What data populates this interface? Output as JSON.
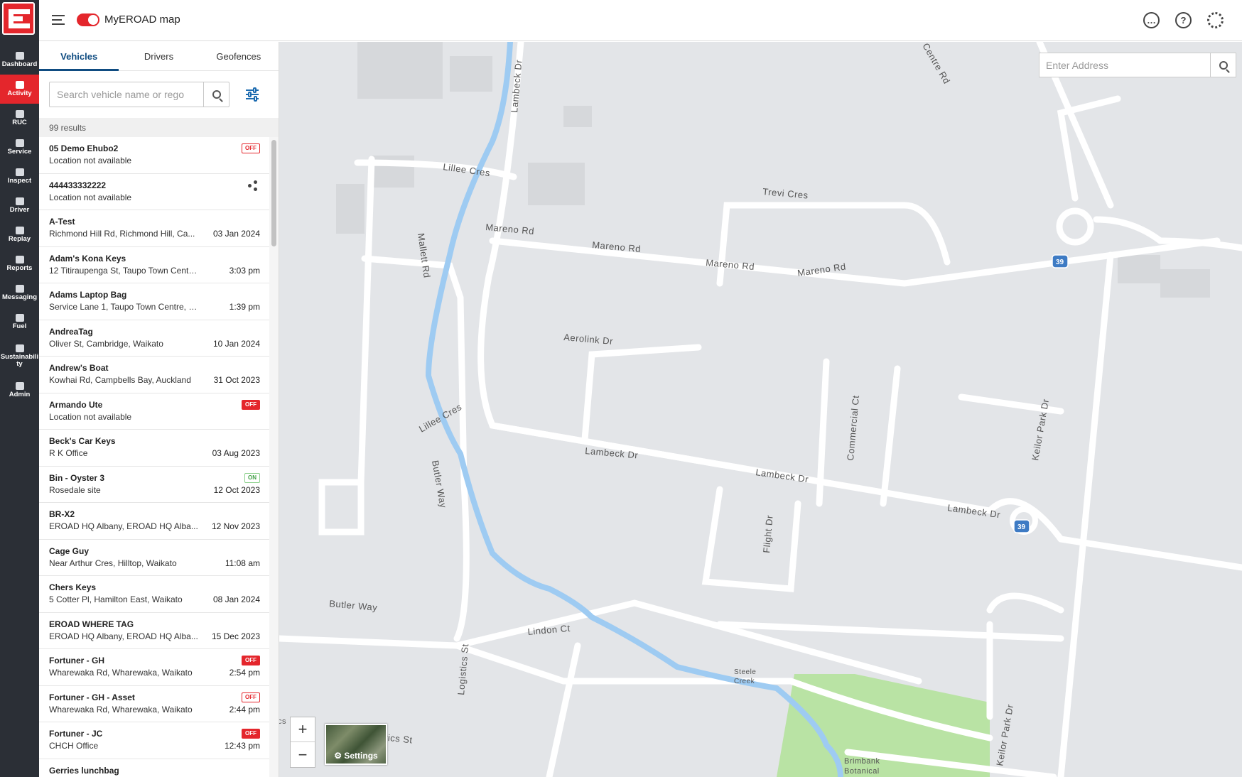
{
  "topbar": {
    "app_title": "MyEROAD map",
    "icons": [
      "chat-icon",
      "help-icon",
      "settings-gear-icon"
    ]
  },
  "rail": {
    "items": [
      {
        "label": "Dashboard",
        "icon": "dashboard-icon"
      },
      {
        "label": "Activity",
        "icon": "map-icon"
      },
      {
        "label": "RUC",
        "icon": "ruc-icon"
      },
      {
        "label": "Service",
        "icon": "service-icon"
      },
      {
        "label": "Inspect",
        "icon": "inspect-icon"
      },
      {
        "label": "Driver",
        "icon": "driver-icon"
      },
      {
        "label": "Replay",
        "icon": "replay-icon"
      },
      {
        "label": "Reports",
        "icon": "reports-icon"
      },
      {
        "label": "Messaging",
        "icon": "messaging-icon"
      },
      {
        "label": "Fuel",
        "icon": "fuel-icon"
      },
      {
        "label": "Sustainabili ty",
        "icon": "leaf-icon"
      },
      {
        "label": "Admin",
        "icon": "admin-icon"
      }
    ],
    "active_color": "#e4262c"
  },
  "panel": {
    "tabs": [
      "Vehicles",
      "Drivers",
      "Geofences"
    ],
    "active_tab": "Vehicles",
    "search_placeholder": "Search vehicle name or rego",
    "results_text": "99 results",
    "vehicles": [
      {
        "name": "05 Demo Ehubo2",
        "location": "Location not available",
        "time": "",
        "badge": "OFF",
        "badge_style": "outline"
      },
      {
        "name": "444433332222",
        "location": "Location not available",
        "time": "",
        "badge": "",
        "badge_style": "share"
      },
      {
        "name": "A-Test",
        "location": "Richmond Hill Rd, Richmond Hill, Ca...",
        "time": "03 Jan 2024",
        "badge": "",
        "badge_style": ""
      },
      {
        "name": "Adam's Kona Keys",
        "location": "12 Titiraupenga St, Taupo Town Centre, ...",
        "time": "3:03 pm",
        "badge": "",
        "badge_style": ""
      },
      {
        "name": "Adams Laptop Bag",
        "location": "Service Lane 1, Taupo Town Centre, Wai...",
        "time": "1:39 pm",
        "badge": "",
        "badge_style": ""
      },
      {
        "name": "AndreaTag",
        "location": "Oliver St, Cambridge, Waikato",
        "time": "10 Jan 2024",
        "badge": "",
        "badge_style": ""
      },
      {
        "name": "Andrew's Boat",
        "location": "Kowhai Rd, Campbells Bay, Auckland",
        "time": "31 Oct 2023",
        "badge": "",
        "badge_style": ""
      },
      {
        "name": "Armando Ute",
        "location": "Location not available",
        "time": "",
        "badge": "OFF",
        "badge_style": "solid"
      },
      {
        "name": "Beck's Car Keys",
        "location": "R K Office",
        "time": "03 Aug 2023",
        "badge": "",
        "badge_style": ""
      },
      {
        "name": "Bin - Oyster 3",
        "location": "Rosedale site",
        "time": "12 Oct 2023",
        "badge": "ON",
        "badge_style": "on"
      },
      {
        "name": "BR-X2",
        "location": "EROAD HQ Albany, EROAD HQ Alba...",
        "time": "12 Nov 2023",
        "badge": "",
        "badge_style": ""
      },
      {
        "name": "Cage Guy",
        "location": "Near Arthur Cres, Hilltop, Waikato",
        "time": "11:08 am",
        "badge": "",
        "badge_style": ""
      },
      {
        "name": "Chers Keys",
        "location": "5 Cotter Pl, Hamilton East, Waikato",
        "time": "08 Jan 2024",
        "badge": "",
        "badge_style": ""
      },
      {
        "name": "EROAD WHERE TAG",
        "location": "EROAD HQ Albany, EROAD HQ Alba...",
        "time": "15 Dec 2023",
        "badge": "",
        "badge_style": ""
      },
      {
        "name": "Fortuner - GH",
        "location": "Wharewaka Rd, Wharewaka, Waikato",
        "time": "2:54 pm",
        "badge": "OFF",
        "badge_style": "solid"
      },
      {
        "name": "Fortuner - GH - Asset",
        "location": "Wharewaka Rd, Wharewaka, Waikato",
        "time": "2:44 pm",
        "badge": "OFF",
        "badge_style": "outline"
      },
      {
        "name": "Fortuner - JC",
        "location": "CHCH Office",
        "time": "12:43 pm",
        "badge": "OFF",
        "badge_style": "solid"
      },
      {
        "name": "Gerries lunchbag",
        "location": "",
        "time": "",
        "badge": "",
        "badge_style": ""
      }
    ]
  },
  "map": {
    "address_placeholder": "Enter Address",
    "zoom_in": "+",
    "zoom_out": "−",
    "layer_label": "⚙ Settings",
    "street_labels": [
      "Lambeck Dr",
      "Lillee Cres",
      "Mareno Rd",
      "Trevi Cres",
      "Aerolink Dr",
      "Mallett Rd",
      "Butler Way",
      "Commercial Ct",
      "Keilor Park Dr",
      "Flight Dr",
      "Lindon Ct",
      "Logistics St",
      "Steele Creek",
      "Brimbank Botanical",
      "Centre Rd",
      "39",
      "cs"
    ],
    "colors": {
      "land": "#e3e5e8",
      "road": "#ffffff",
      "creek": "#9ecbf2",
      "park": "#b9e3a4",
      "building": "#d6d8db"
    }
  }
}
